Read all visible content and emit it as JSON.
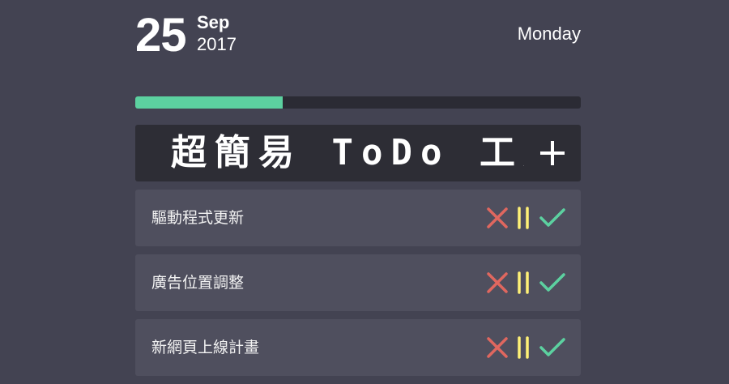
{
  "header": {
    "day": "25",
    "month": "Sep",
    "year": "2017",
    "weekday": "Monday"
  },
  "progress": {
    "fraction": 0.33,
    "fill_color": "#5cd1a0"
  },
  "add_task": {
    "value": "超簡易 ToDo 工具",
    "button_icon": "plus-icon"
  },
  "tasks": [
    {
      "text": "驅動程式更新",
      "actions": [
        "close-icon",
        "pause-icon",
        "check-icon"
      ]
    },
    {
      "text": "廣告位置調整",
      "actions": [
        "close-icon",
        "pause-icon",
        "check-icon"
      ]
    },
    {
      "text": "新網頁上線計畫",
      "actions": [
        "close-icon",
        "pause-icon",
        "check-icon"
      ]
    }
  ],
  "colors": {
    "background": "#434352",
    "delete": "#e0675f",
    "pause": "#fff176",
    "complete": "#5cd1a0"
  }
}
